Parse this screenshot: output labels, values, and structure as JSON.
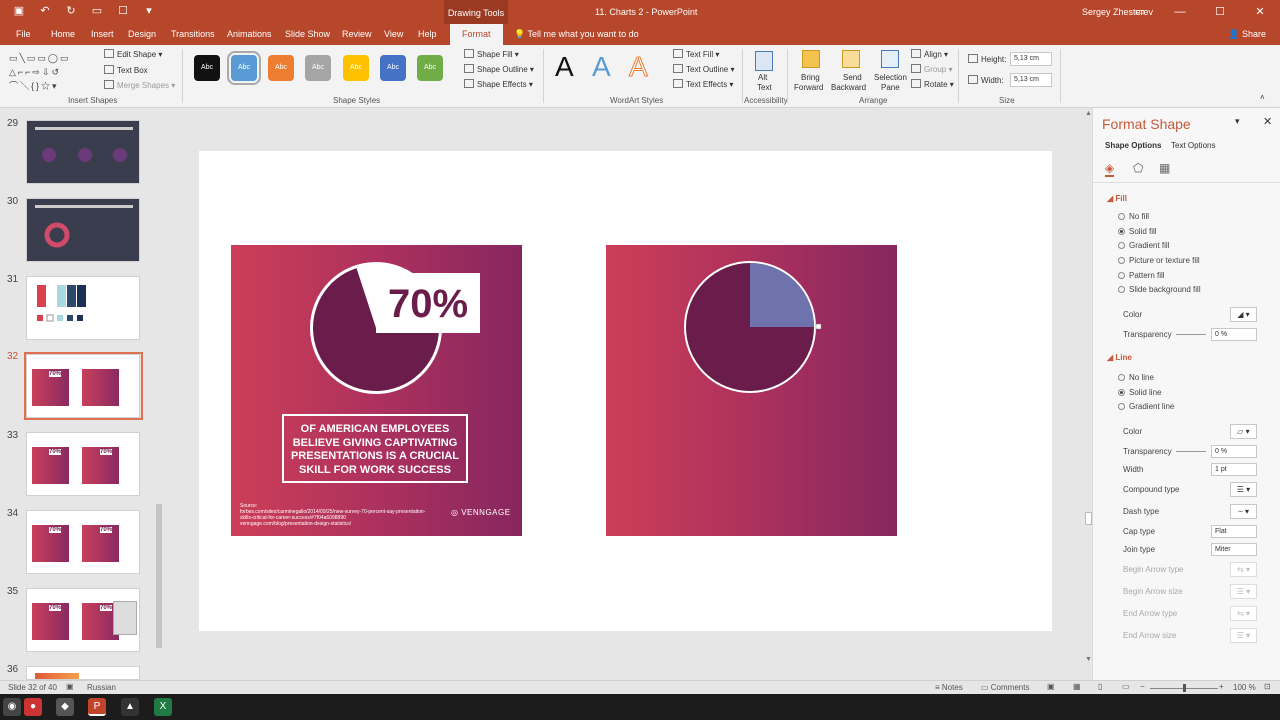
{
  "titlebar": {
    "drawing_tools": "Drawing Tools",
    "doc_title": "11. Charts 2  -  PowerPoint",
    "user": "Sergey Zhesterev"
  },
  "tabs": [
    "File",
    "Home",
    "Insert",
    "Design",
    "Transitions",
    "Animations",
    "Slide Show",
    "Review",
    "View",
    "Help",
    "Format"
  ],
  "tell_me": "Tell me what you want to do",
  "share": "Share",
  "ribbon": {
    "insert_shapes": {
      "label": "Insert Shapes",
      "edit_shape": "Edit Shape",
      "text_box": "Text Box",
      "merge_shapes": "Merge Shapes"
    },
    "shape_styles": {
      "label": "Shape Styles",
      "swatch_text": "Abc",
      "swatch_colors": [
        "#111111",
        "#5b9bd5",
        "#ed7d31",
        "#a5a5a5",
        "#ffc000",
        "#4472c4",
        "#70ad47"
      ],
      "fill": "Shape Fill",
      "outline": "Shape Outline",
      "effects": "Shape Effects"
    },
    "wordart": {
      "label": "WordArt Styles",
      "letter": "A",
      "text_fill": "Text Fill",
      "text_outline": "Text Outline",
      "text_effects": "Text Effects"
    },
    "accessibility": {
      "label": "Accessibility",
      "alt_text_1": "Alt",
      "alt_text_2": "Text"
    },
    "arrange": {
      "label": "Arrange",
      "bring_forward_1": "Bring",
      "bring_forward_2": "Forward",
      "send_backward_1": "Send",
      "send_backward_2": "Backward",
      "selection_pane_1": "Selection",
      "selection_pane_2": "Pane",
      "align": "Align",
      "group": "Group",
      "rotate": "Rotate"
    },
    "size": {
      "label": "Size",
      "height_label": "Height:",
      "height_value": "5,13 cm",
      "width_label": "Width:",
      "width_value": "5,13 cm"
    }
  },
  "thumbnails": [
    {
      "num": "29",
      "dark": true
    },
    {
      "num": "30",
      "dark": true
    },
    {
      "num": "31",
      "dark": false
    },
    {
      "num": "32",
      "dark": false,
      "selected": true,
      "pct": "70%"
    },
    {
      "num": "33",
      "dark": false,
      "pct": "70%",
      "pct2": "70%"
    },
    {
      "num": "34",
      "dark": false,
      "pct": "70%",
      "pct2": "70%"
    },
    {
      "num": "35",
      "dark": false,
      "pct": "70%",
      "pct2": "70%"
    },
    {
      "num": "36",
      "dark": false
    }
  ],
  "slide": {
    "left_card": {
      "percent_label": "70%",
      "stat_line1": "OF AMERICAN EMPLOYEES",
      "stat_line2": "BELIEVE GIVING  CAPTIVATING",
      "stat_line3": "PRESENTATIONS IS A CRUCIAL",
      "stat_line4": "SKILL FOR WORK SUCCESS",
      "source_title": "Source:",
      "source_1": "forbes.com/sites/carminegallo/2014/09/25/new-survey-70-percent-say-presentation-",
      "source_2": "skills-critical-for-career-success/#7f04a6098890",
      "source_3": "venngage.com/blog/presentation-design-statistics/",
      "brand": "VENNGAGE",
      "pie_fraction": 0.7
    },
    "right_card": {
      "pie_fraction_highlight": 0.25,
      "highlight_color": "#6f73ad"
    }
  },
  "format_panel": {
    "title": "Format Shape",
    "tab_shape": "Shape Options",
    "tab_text": "Text Options",
    "fill_section": "Fill",
    "fill_options": [
      "No fill",
      "Solid fill",
      "Gradient fill",
      "Picture or texture fill",
      "Pattern fill",
      "Slide background fill"
    ],
    "fill_selected": 1,
    "fill_color": "Color",
    "fill_transparency": "Transparency",
    "fill_transparency_value": "0 %",
    "line_section": "Line",
    "line_options": [
      "No line",
      "Solid line",
      "Gradient line"
    ],
    "line_selected": 1,
    "line_color": "Color",
    "line_transparency": "Transparency",
    "line_transparency_value": "0 %",
    "width": "Width",
    "width_value": "1 pt",
    "compound_type": "Compound type",
    "dash_type": "Dash type",
    "cap_type": "Cap type",
    "cap_value": "Flat",
    "join_type": "Join type",
    "join_value": "Miter",
    "begin_arrow_type": "Begin Arrow type",
    "begin_arrow_size": "Begin Arrow size",
    "end_arrow_type": "End Arrow type",
    "end_arrow_size": "End Arrow size"
  },
  "statusbar": {
    "slide_info": "Slide 32 of 40",
    "language": "Russian",
    "notes": "Notes",
    "comments": "Comments",
    "zoom": "100 %"
  }
}
